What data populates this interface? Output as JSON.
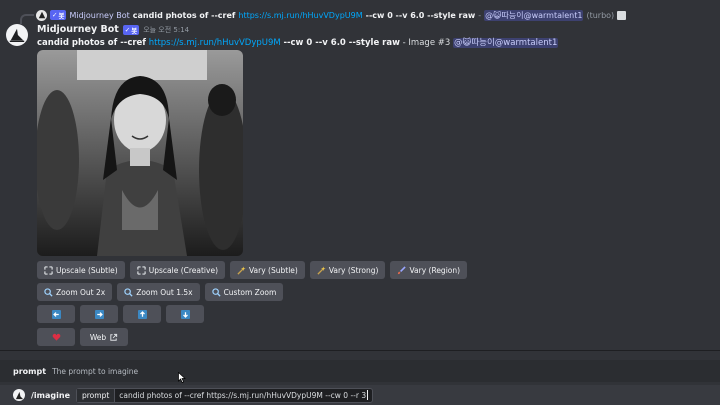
{
  "reply": {
    "bot_name": "Midjourney Bot",
    "bot_badge": "봇",
    "prompt_bold": "candid photos of --cref",
    "link": "https://s.mj.run/hHuvVDypU9M",
    "params": "--cw 0 --v 6.0 --style raw",
    "sep": "-",
    "mention": "@😺따능이@warmtalent1",
    "mode": "(turbo)"
  },
  "message": {
    "author": "Midjourney Bot",
    "badge": "봇",
    "timestamp": "오늘 오전 5:14",
    "prompt_bold": "candid photos of --cref",
    "link": "https://s.mj.run/hHuvVDypU9M",
    "params": "--cw 0 --v 6.0 --style raw",
    "suffix": "- Image #3",
    "mention": "@😺따능이@warmtalent1"
  },
  "buttons": {
    "row1": [
      {
        "label": "Upscale (Subtle)",
        "icon": "upscale-icon"
      },
      {
        "label": "Upscale (Creative)",
        "icon": "upscale-icon"
      },
      {
        "label": "Vary (Subtle)",
        "icon": "magic-wand-icon"
      },
      {
        "label": "Vary (Strong)",
        "icon": "magic-wand-icon"
      },
      {
        "label": "Vary (Region)",
        "icon": "brush-icon"
      }
    ],
    "row2": [
      {
        "label": "Zoom Out 2x",
        "icon": "magnifier-icon"
      },
      {
        "label": "Zoom Out 1.5x",
        "icon": "magnifier-icon"
      },
      {
        "label": "Custom Zoom",
        "icon": "magnifier-icon"
      }
    ],
    "row3": [
      {
        "icon": "arrow-left-icon"
      },
      {
        "icon": "arrow-right-icon"
      },
      {
        "icon": "arrow-up-icon"
      },
      {
        "icon": "arrow-down-icon"
      }
    ],
    "row4": {
      "like_icon": "heart-icon",
      "web_label": "Web",
      "web_icon": "external-link-icon"
    }
  },
  "option_hint": {
    "name": "prompt",
    "description": "The prompt to imagine"
  },
  "input": {
    "command": "/imagine",
    "option_key": "prompt",
    "option_value": "candid photos of --cref https://s.mj.run/hHuvVDypU9M --cw 0 --r 3"
  },
  "colors": {
    "accent": "#5865f2",
    "link": "#00a8fc",
    "button": "#4e5058",
    "background": "#313338"
  }
}
